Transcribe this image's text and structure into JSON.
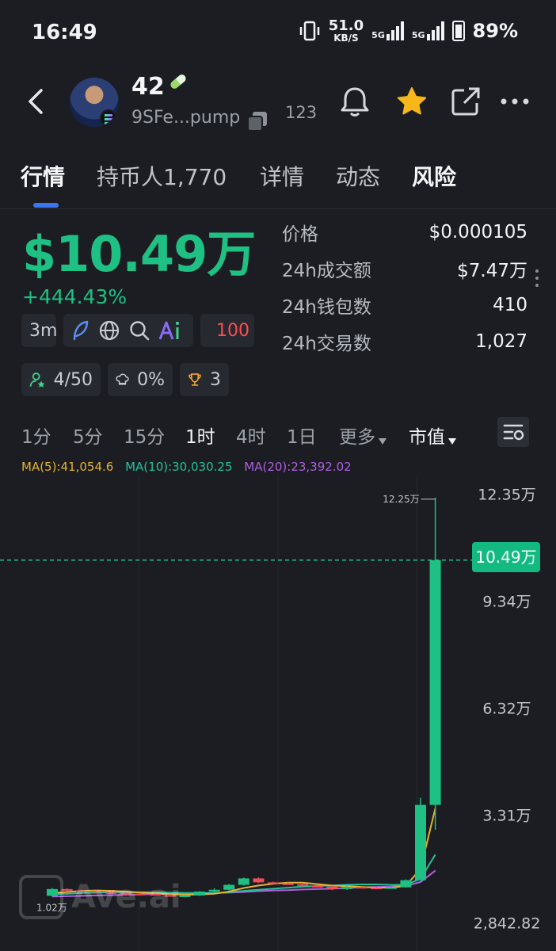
{
  "status_bar": {
    "time": "16:49",
    "net_speed": "51.0",
    "net_unit": "KB/S",
    "signal1": "5G",
    "signal2": "5G",
    "battery": "89%"
  },
  "header": {
    "token_name": "42",
    "address": "9SFe...pump",
    "holders_count": "123"
  },
  "tabs": [
    {
      "label": "行情",
      "active": true
    },
    {
      "label": "持币人1,770"
    },
    {
      "label": "详情"
    },
    {
      "label": "动态"
    },
    {
      "label": "风险"
    }
  ],
  "price": {
    "market_cap": "$10.49万",
    "change": "+444.43%"
  },
  "stats": [
    {
      "label": "价格",
      "value": "$0.000105"
    },
    {
      "label": "24h成交额",
      "value": "$7.47万"
    },
    {
      "label": "24h钱包数",
      "value": "410"
    },
    {
      "label": "24h交易数",
      "value": "1,027"
    }
  ],
  "chips": {
    "age": "3m",
    "run_value": "100",
    "holders_ratio": "4/50",
    "chef_pct": "0%",
    "trophy_count": "3"
  },
  "intervals": {
    "items": [
      "1分",
      "5分",
      "15分",
      "1时",
      "4时",
      "1日"
    ],
    "active": "1时",
    "more": "更多",
    "metric": "市值"
  },
  "ma": {
    "ma5": "MA(5):41,054.6",
    "ma10": "MA(10):30,030.25",
    "ma20": "MA(20):23,392.02"
  },
  "colors": {
    "up": "#1fc084",
    "down": "#f04e5a",
    "ma5": "#e5b333",
    "ma10": "#26c29a",
    "ma20": "#b15ee0",
    "accent": "#3a76f0"
  },
  "chart_data": {
    "type": "candlestick",
    "y_ticks": [
      "12.35万",
      "9.34万",
      "6.32万",
      "3.31万",
      "2,842.82"
    ],
    "high_label": "12.25万",
    "low_label": "1.02万",
    "current_label": "10.49万",
    "y_range": [
      -2900,
      125600
    ],
    "candles": [
      {
        "o": 10400,
        "h": 12600,
        "l": 10200,
        "c": 12300
      },
      {
        "o": 12300,
        "h": 12500,
        "l": 11700,
        "c": 11900
      },
      {
        "o": 11900,
        "h": 12100,
        "l": 11500,
        "c": 11800
      },
      {
        "o": 11800,
        "h": 12000,
        "l": 11300,
        "c": 11400
      },
      {
        "o": 11400,
        "h": 11900,
        "l": 11000,
        "c": 11200
      },
      {
        "o": 11200,
        "h": 11500,
        "l": 10800,
        "c": 11000
      },
      {
        "o": 11000,
        "h": 11200,
        "l": 10700,
        "c": 10900
      },
      {
        "o": 10900,
        "h": 11100,
        "l": 10500,
        "c": 10600
      },
      {
        "o": 10600,
        "h": 10900,
        "l": 10300,
        "c": 10400
      },
      {
        "o": 10400,
        "h": 10700,
        "l": 10200,
        "c": 10500
      },
      {
        "o": 10500,
        "h": 11700,
        "l": 10400,
        "c": 11600
      },
      {
        "o": 11600,
        "h": 12500,
        "l": 11400,
        "c": 12100
      },
      {
        "o": 12100,
        "h": 13700,
        "l": 11900,
        "c": 13500
      },
      {
        "o": 13500,
        "h": 15500,
        "l": 13300,
        "c": 15300
      },
      {
        "o": 15300,
        "h": 15600,
        "l": 14000,
        "c": 14200
      },
      {
        "o": 14200,
        "h": 14400,
        "l": 13700,
        "c": 13900
      },
      {
        "o": 13900,
        "h": 14200,
        "l": 13500,
        "c": 13700
      },
      {
        "o": 13700,
        "h": 14000,
        "l": 13000,
        "c": 13200
      },
      {
        "o": 13200,
        "h": 13500,
        "l": 12800,
        "c": 13000
      },
      {
        "o": 13000,
        "h": 13200,
        "l": 12000,
        "c": 12300
      },
      {
        "o": 12300,
        "h": 13200,
        "l": 12100,
        "c": 12900
      },
      {
        "o": 12900,
        "h": 13200,
        "l": 12500,
        "c": 12700
      },
      {
        "o": 12700,
        "h": 12900,
        "l": 12400,
        "c": 12600
      },
      {
        "o": 12600,
        "h": 13000,
        "l": 12400,
        "c": 12800
      },
      {
        "o": 12800,
        "h": 15000,
        "l": 12700,
        "c": 14800
      },
      {
        "o": 14800,
        "h": 38000,
        "l": 14600,
        "c": 36000
      },
      {
        "o": 36000,
        "h": 122500,
        "l": 29000,
        "c": 104900
      }
    ],
    "ma5": [
      11200,
      11500,
      11800,
      11900,
      11800,
      11600,
      11300,
      11100,
      10900,
      10700,
      10800,
      11000,
      11600,
      12600,
      13300,
      13800,
      14100,
      14100,
      13700,
      13300,
      13100,
      12900,
      12700,
      12700,
      13200,
      18000,
      35000
    ],
    "ma10": [
      10900,
      11000,
      11200,
      11300,
      11400,
      11400,
      11400,
      11400,
      11300,
      11200,
      11200,
      11200,
      11400,
      11800,
      12100,
      12400,
      12700,
      13000,
      13200,
      13300,
      13500,
      13600,
      13600,
      13500,
      13500,
      15200,
      22000
    ],
    "ma20": [
      10200,
      10300,
      10400,
      10500,
      10600,
      10700,
      10800,
      10900,
      10950,
      11000,
      11100,
      11200,
      11300,
      11500,
      11700,
      11900,
      12000,
      12200,
      12300,
      12400,
      12600,
      12800,
      12900,
      13000,
      13200,
      14300,
      17500
    ]
  }
}
